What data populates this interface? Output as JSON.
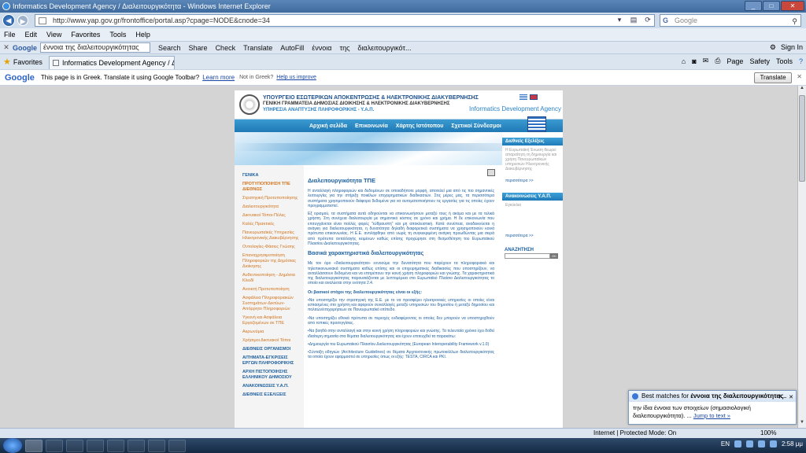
{
  "window": {
    "title": "Informatics Development Agency / Διαλειτουργικότητα - Windows Internet Explorer"
  },
  "address": {
    "url": "http://www.yap.gov.gr/frontoffice/portal.asp?cpage=NODE&cnode=34"
  },
  "search": {
    "placeholder": "Google"
  },
  "menu": [
    "File",
    "Edit",
    "View",
    "Favorites",
    "Tools",
    "Help"
  ],
  "google_toolbar": {
    "query": "έννοια της διαλειτουργικότητας",
    "items": [
      "Search",
      "Share",
      "Check",
      "Translate",
      "AutoFill",
      "έννοια",
      "της",
      "διαλειτουργικότ..."
    ],
    "sign_in": "Sign In"
  },
  "tabs": {
    "favorites": "Favorites",
    "active_tab": "Informatics Development Agency / Δ...",
    "page": "Page",
    "safety": "Safety",
    "tools": "Tools"
  },
  "translate_bar": {
    "message": "This page is in Greek.  Translate it using Google Toolbar?",
    "learn_more": "Learn more",
    "not_greek": "Not in Greek?",
    "help": "Help us improve",
    "button": "Translate"
  },
  "site": {
    "ministry": "ΥΠΟΥΡΓΕΙΟ ΕΣΩΤΕΡΙΚΩΝ ΑΠΟΚΕΝΤΡΩΣΗΣ & ΗΛΕΚΤΡΟΝΙΚΗΣ ΔΙΑΚΥΒΕΡΝΗΣΗΣ",
    "secretariat": "ΓΕΝΙΚΗ ΓΡΑΜΜΑΤΕΙΑ ΔΗΜΟΣΙΑΣ ΔΙΟΙΚΗΣΗΣ & ΗΛΕΚΤΡΟΝΙΚΗΣ ΔΙΑΚΥΒΕΡΝΗΣΗΣ",
    "service": "ΥΠΗΡΕΣΙΑ ΑΝΑΠΤΥΞΗΣ ΠΛΗΡΟΦΟΡΙΚΗΣ - Υ.Α.Π.",
    "agency": "Informatics Development Agency",
    "nav": [
      "Αρχική σελίδα",
      "Επικοινωνία",
      "Χάρτης Ιστότοπου",
      "Σχετικοί Σύνδεσμοι"
    ],
    "leftnav": [
      {
        "label": "ΓΕΝΙΚΑ",
        "kind": "main"
      },
      {
        "label": "ΠΡΟΤΥΠΟΠΟΙΗΣΗ ΤΠΕ ΔΙΕΘΝΩΣ",
        "kind": "active"
      },
      {
        "label": "Στρατηγική Προτυποποίησης",
        "kind": "sub"
      },
      {
        "label": "Διαλειτουργικότητα",
        "kind": "sub"
      },
      {
        "label": "Δικτυακοί Τόποι-Πύλες",
        "kind": "sub"
      },
      {
        "label": "Καλές Πρακτικές",
        "kind": "sub"
      },
      {
        "label": "Πανευρωπαϊκές Υπηρεσίες Ηλεκτρονικής Διακυβέρνησης",
        "kind": "sub"
      },
      {
        "label": "Οντολογίες-Φάσεις Γνώσης",
        "kind": "sub"
      },
      {
        "label": "Επαναχρησιμοποίηση Πληροφοριών της Δημόσιας Διοίκησης",
        "kind": "sub"
      },
      {
        "label": "Αυθεντικοποίηση - Δημόσια Κλειδί",
        "kind": "sub"
      },
      {
        "label": "Ανοικτή Προτυποποίηση",
        "kind": "sub"
      },
      {
        "label": "Ασφάλεια Πληροφοριακών Συστημάτων-Δικτύων-Απόρρητο Πληροφοριών",
        "kind": "sub"
      },
      {
        "label": "Υγιεινή και Ασφάλεια Εργαζομένων σε ΤΠΕ",
        "kind": "sub"
      },
      {
        "label": "Ακρωνύμια",
        "kind": "sub"
      },
      {
        "label": "Χρήσιμοι Δικτυακοί Τόποι",
        "kind": "sub"
      },
      {
        "label": "ΔΙΕΘΝΕΙΣ ΟΡΓΑΝΙΣΜΟΙ",
        "kind": "main"
      },
      {
        "label": "ΑΙΤΗΜΑΤΑ-ΕΓΚΡΙΣΕΙΣ ΕΡΓΩΝ ΠΛΗΡΟΦΟΡΙΚΗΣ",
        "kind": "main"
      },
      {
        "label": "ΑΡΧΗ ΠΙΣΤΟΠΟΙΗΣΗΣ ΕΛΛΗΝΙΚΟΥ ΔΗΜΟΣΙΟΥ",
        "kind": "main"
      },
      {
        "label": "ΑΝΑΚΟΙΝΩΣΕΙΣ Υ.Α.Π.",
        "kind": "main"
      },
      {
        "label": "ΔΙΕΘΝΕΙΣ ΕΞΕΛΙΞΕΙΣ",
        "kind": "main"
      }
    ],
    "content": {
      "heading": "Διαλειτουργικότητα ΤΠΕ",
      "p1": "Η ανταλλαγή πληροφοριών και δεδομένων σε οποιαδήποτε μορφή, αποτελεί μια από τις πιο σημαντικές λειτουργίες για την στήριξη ποικίλων επιχειρηματικών διαδικασιών. Στις μέρες μας, τα περισσότερα συστήματα χρησιμοποιούν διάφορα δεδομένα για να αυτοματοποιήσουν τις εργασίες για τις οποίες έχουν προγραμματιστεί.",
      "p2": "Εξ ορισμού, τα συστήματα αυτά οδηγούνται να επικοινωνήσουν μεταξύ τους ή ακόμα και με τα τελικά χρήστη. Στη συνέχεια διαλειτουργία με σημαντικό κόστος σε χρόνο και χρήμα. Η δε επικοινωνία που επιτυγχάνεται είναι πολλές φορές \"εύθραυστη\" και μη αποκλειστική. Κατά συνέπεια, αναδεικνύεται η ανάγκη για διαλειτουργικότητα, η δυνατότητα δηλαδή διαφορετικά συστήματα να χρησιμοποιούν κοινά πρότυπα επικοινωνίας. Η Ε.Ε. αντιλήφθηκε από νωρίς τη συγκεκριμένη ανάγκη προωθώντας μια σειρά από πρότυπα ανταλλαγής κειμένων καθώς επίσης προχώρησε στη θεσμοθέτηση του Ευρωπαϊκού Πλαισίου Διαλειτουργικότητας.",
      "subheading": "Βασικά χαρακτηριστικά διαλειτουργικότητας",
      "p3": "Με τον όρο «διαλειτουργικότητα» εννοούμε την δυνατότητα που παρέχουν τα πληροφοριακά και τηλεπικοινωνιακά συστήματα καθώς επίσης και οι επιχειρηματικές διαδικασίες που υποστηρίζουν, να ανταλλάσσουν δεδομένα και να επιτρέπουν την κοινή χρήση πληροφοριών και γνώσης. Τα χαρακτηριστικά της διαλειτουργικότητας παρουσιάζονται με λεπτομέρεια στο Ευρωπαϊκό Πλαίσιο Διαλειτουργικότητας το οποίο και αναλύεται στην ενότητα 2.4.",
      "goals_heading": "Οι βασικοί στόχοι της διαλειτουργικότητας είναι οι εξής:",
      "g1": "•Να υποστηρίξει την στρατηγική της Ε.Ε. με το να προσφέρει ηλεκτρονικές υπηρεσίες οι οποίες είναι εστιασμένες στο χρήστη και αφορούν συναλλαγές μεταξύ υπηρεσιών του δημοσίου ή μεταξύ δημοσίου και πολιτών/επιχειρήσεων σε Πανευρωπαϊκό επίπεδο.",
      "g2": "•Να υποστηρίξει εθνικά πρότυπα σε περιοχές ενδιαφέροντος οι οποίες δεν μπορούν να υποστηριχθούν από τοπικές προσεγγίσεις.",
      "g3": "•Να βοηθά στην ανταλλαγή και στην κοινή χρήση πληροφοριών και γνώσης. Τα τελευταία χρόνια έχει δοθεί ιδιαίτερη σημασία στα θέματα διαλειτουργικότητας και έχουν επιτευχθεί τα παρακάτω:",
      "g4": "•Δημιουργία του Ευρωπαϊκού Πλαισίου Διαλειτουργικότητας (European Interoperability Framework v.1.0)",
      "g5": "•Σύνταξη οδηγιών (Architecture Guidelines) σε θέματα Αρχιτεκτονικής πρωτοκόλλων διαλειτουργικότητας τα οποία έχουν εφαρμοστεί σε υπηρεσίες όπως οι εξής: TESTA, CIRCA και PKI."
    },
    "right": {
      "box1_title": "Διεθνείς Εξελίξεις",
      "box1_text": "Η Ευρωπαϊκή Ένωση θεωρεί απαραίτητη τη δημιουργία και χρήση Πανευρωπαϊκών υπηρεσιών Ηλεκτρονικής Διακυβέρνησης",
      "more1": "περισσότερα >>",
      "box2_title": "Ανακοινώσεις Υ.Α.Π.",
      "box2_text": "Εγκύκλια",
      "more2": "περισσότερα >>",
      "search_label": "ΑΝΑΖΗΤΗΣΗ",
      "search_btn": "OK"
    }
  },
  "popup": {
    "title_prefix": "Best matches for ",
    "title_query": "έννοια της διαλειτουργικότητας",
    "body": "την ίδια έννοια των στοιχείων (σημασιολογική διαλειτουργικότητα). ...",
    "jump": "Jump to text »"
  },
  "status": {
    "zone": "Internet | Protected Mode: On",
    "zoom": "100%"
  },
  "taskbar": {
    "lang": "EN",
    "time": "2:58 μμ"
  }
}
